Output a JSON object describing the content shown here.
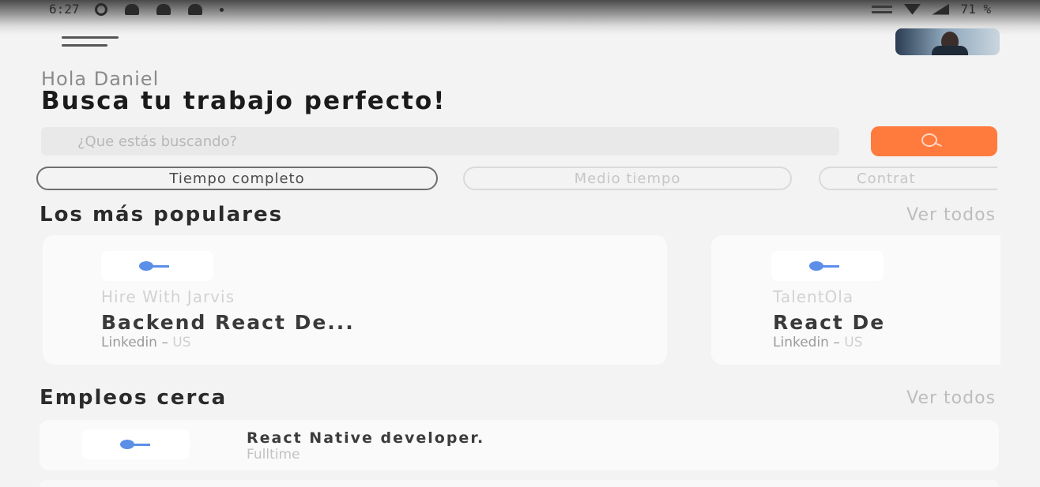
{
  "status_bar": {
    "time": "6:27",
    "battery": "71 %",
    "icons": [
      "notification-icon",
      "bell-icon",
      "bell-icon",
      "bell-icon",
      "dot-icon",
      "volume-icon",
      "wifi-icon",
      "signal-icon",
      "battery-icon"
    ]
  },
  "header": {
    "greeting": "Hola Daniel",
    "headline": "Busca tu trabajo perfecto!"
  },
  "search": {
    "placeholder": "¿Que estás buscando?",
    "value": "",
    "button_icon": "search-icon",
    "button_color": "#ff7a3d"
  },
  "filters": [
    {
      "label": "Tiempo completo",
      "selected": true
    },
    {
      "label": "Medio tiempo",
      "selected": false
    },
    {
      "label": "Contrat",
      "selected": false
    }
  ],
  "popular": {
    "title": "Los más populares",
    "see_all": "Ver todos",
    "jobs": [
      {
        "company": "Hire With Jarvis",
        "title": "Backend React De...",
        "source": "Linkedin",
        "separator": " – ",
        "location": "US",
        "logo_icon": "company-logo-icon"
      },
      {
        "company": "TalentOla",
        "title": "React De",
        "source": "Linkedin",
        "separator": " – ",
        "location": "US",
        "logo_icon": "company-logo-icon"
      }
    ]
  },
  "nearby": {
    "title": "Empleos cerca",
    "see_all": "Ver todos",
    "jobs": [
      {
        "title": "React Native developer.",
        "type": "Fulltime",
        "logo_icon": "company-logo-icon"
      }
    ]
  }
}
